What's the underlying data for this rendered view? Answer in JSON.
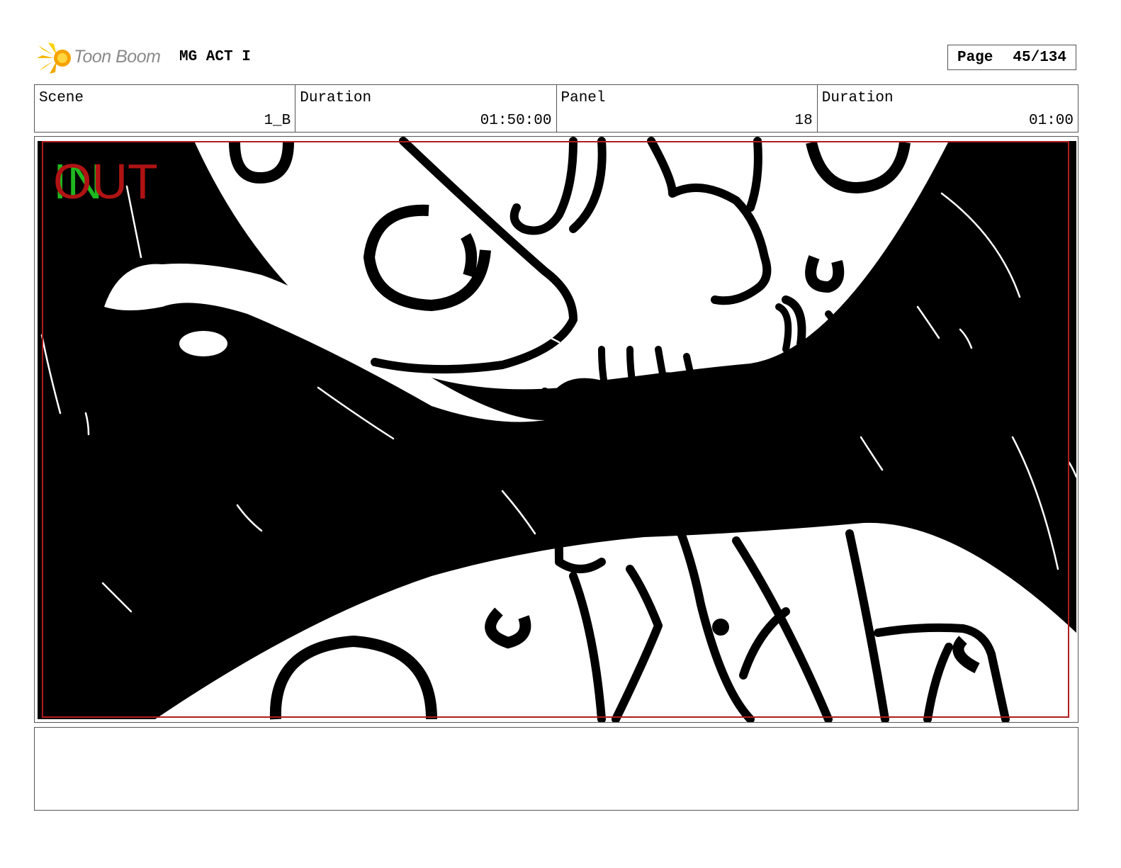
{
  "header": {
    "logo_text": "Toon Boom",
    "project_title": "MG ACT I",
    "page_label": "Page",
    "page_value": "45/134"
  },
  "info": {
    "scene_label": "Scene",
    "scene_value": "1_B",
    "duration_label": "Duration",
    "duration_value": "01:50:00",
    "panel_label": "Panel",
    "panel_value": "18",
    "panel_duration_label": "Duration",
    "panel_duration_value": "01:00"
  },
  "panel_overlay": {
    "in_text": "IN",
    "out_text": "OUT",
    "in_color": "#1fb81f",
    "out_color": "#b01313",
    "safe_frame_color": "#b01c1c"
  },
  "notes": {
    "text": ""
  }
}
